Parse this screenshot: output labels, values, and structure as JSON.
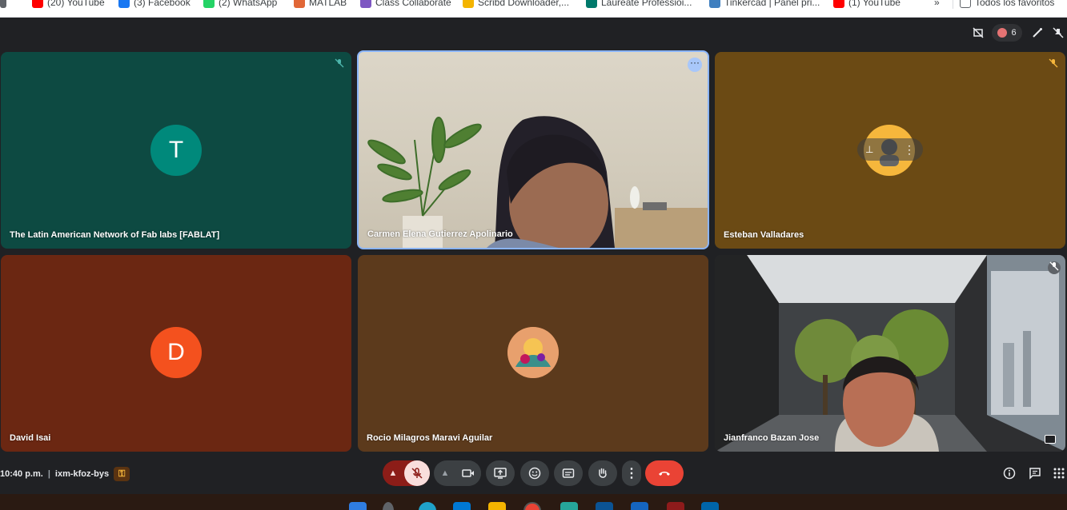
{
  "bookmarks": [
    {
      "label": "(20) YouTube",
      "color": "#ff0000"
    },
    {
      "label": "(3) Facebook",
      "color": "#1877f2"
    },
    {
      "label": "(2) WhatsApp",
      "color": "#25d366"
    },
    {
      "label": "MATLAB",
      "color": "#e16737"
    },
    {
      "label": "Class Collaborate",
      "color": "#7e57c2"
    },
    {
      "label": "Scribd Downloader,...",
      "color": "#f4b400"
    },
    {
      "label": "Laureate Professioi...",
      "color": "#00796b"
    },
    {
      "label": "Tinkercad | Panel pri...",
      "color": "#3f7fbf"
    },
    {
      "label": "(1) YouTube",
      "color": "#ff0000"
    }
  ],
  "bookmarks_overflow": "»",
  "all_bookmarks": "Todos los favoritos",
  "topbar": {
    "participants_count": "6"
  },
  "tiles": [
    {
      "name": "The Latin American Network of Fab labs [FABLAT]",
      "initial": "T",
      "bg": "#0d4a42",
      "avatar_color": "#00897b",
      "muted": true
    },
    {
      "name": "Carmen Elena Gutierrez Apolinario",
      "video": true
    },
    {
      "name": "Esteban Valladares",
      "bg": "#6b4a14",
      "avatar_color": "#f6b73c",
      "muted": true
    },
    {
      "name": "David Isai",
      "initial": "D",
      "bg": "#6b2712",
      "avatar_color": "#f4511e"
    },
    {
      "name": "Rocio Milagros Maravi Aguilar",
      "bg": "#5c3a1c",
      "avatar_color": "#d98a5b"
    },
    {
      "name": "Jianfranco Bazan Jose",
      "video": true
    }
  ],
  "bottom": {
    "time": "10:40 p.m.",
    "separator": "|",
    "meeting_code": "ixm-kfoz-bys"
  },
  "colors": {
    "end_call": "#ea4335",
    "mic_off_bg": "#f9dedc",
    "mic_group_bg": "#8c1d18"
  }
}
